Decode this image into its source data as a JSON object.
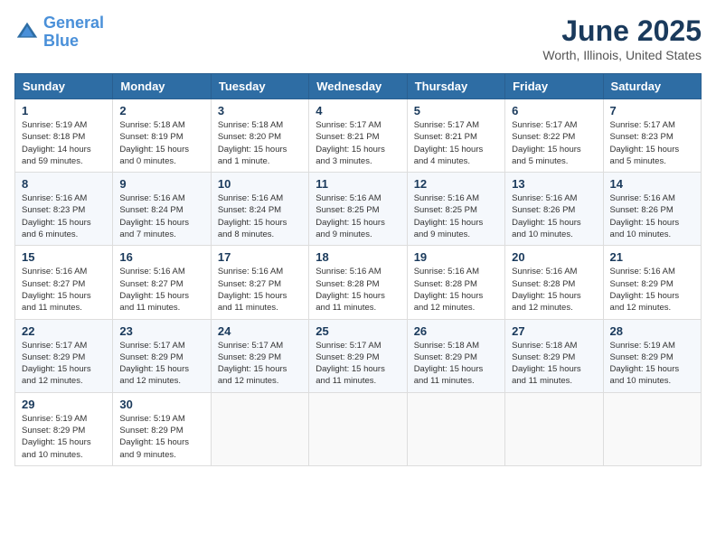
{
  "logo": {
    "line1": "General",
    "line2": "Blue"
  },
  "title": "June 2025",
  "subtitle": "Worth, Illinois, United States",
  "weekdays": [
    "Sunday",
    "Monday",
    "Tuesday",
    "Wednesday",
    "Thursday",
    "Friday",
    "Saturday"
  ],
  "weeks": [
    [
      {
        "day": "1",
        "sunrise": "5:19 AM",
        "sunset": "8:18 PM",
        "daylight": "14 hours and 59 minutes."
      },
      {
        "day": "2",
        "sunrise": "5:18 AM",
        "sunset": "8:19 PM",
        "daylight": "15 hours and 0 minutes."
      },
      {
        "day": "3",
        "sunrise": "5:18 AM",
        "sunset": "8:20 PM",
        "daylight": "15 hours and 1 minute."
      },
      {
        "day": "4",
        "sunrise": "5:17 AM",
        "sunset": "8:21 PM",
        "daylight": "15 hours and 3 minutes."
      },
      {
        "day": "5",
        "sunrise": "5:17 AM",
        "sunset": "8:21 PM",
        "daylight": "15 hours and 4 minutes."
      },
      {
        "day": "6",
        "sunrise": "5:17 AM",
        "sunset": "8:22 PM",
        "daylight": "15 hours and 5 minutes."
      },
      {
        "day": "7",
        "sunrise": "5:17 AM",
        "sunset": "8:23 PM",
        "daylight": "15 hours and 5 minutes."
      }
    ],
    [
      {
        "day": "8",
        "sunrise": "5:16 AM",
        "sunset": "8:23 PM",
        "daylight": "15 hours and 6 minutes."
      },
      {
        "day": "9",
        "sunrise": "5:16 AM",
        "sunset": "8:24 PM",
        "daylight": "15 hours and 7 minutes."
      },
      {
        "day": "10",
        "sunrise": "5:16 AM",
        "sunset": "8:24 PM",
        "daylight": "15 hours and 8 minutes."
      },
      {
        "day": "11",
        "sunrise": "5:16 AM",
        "sunset": "8:25 PM",
        "daylight": "15 hours and 9 minutes."
      },
      {
        "day": "12",
        "sunrise": "5:16 AM",
        "sunset": "8:25 PM",
        "daylight": "15 hours and 9 minutes."
      },
      {
        "day": "13",
        "sunrise": "5:16 AM",
        "sunset": "8:26 PM",
        "daylight": "15 hours and 10 minutes."
      },
      {
        "day": "14",
        "sunrise": "5:16 AM",
        "sunset": "8:26 PM",
        "daylight": "15 hours and 10 minutes."
      }
    ],
    [
      {
        "day": "15",
        "sunrise": "5:16 AM",
        "sunset": "8:27 PM",
        "daylight": "15 hours and 11 minutes."
      },
      {
        "day": "16",
        "sunrise": "5:16 AM",
        "sunset": "8:27 PM",
        "daylight": "15 hours and 11 minutes."
      },
      {
        "day": "17",
        "sunrise": "5:16 AM",
        "sunset": "8:27 PM",
        "daylight": "15 hours and 11 minutes."
      },
      {
        "day": "18",
        "sunrise": "5:16 AM",
        "sunset": "8:28 PM",
        "daylight": "15 hours and 11 minutes."
      },
      {
        "day": "19",
        "sunrise": "5:16 AM",
        "sunset": "8:28 PM",
        "daylight": "15 hours and 12 minutes."
      },
      {
        "day": "20",
        "sunrise": "5:16 AM",
        "sunset": "8:28 PM",
        "daylight": "15 hours and 12 minutes."
      },
      {
        "day": "21",
        "sunrise": "5:16 AM",
        "sunset": "8:29 PM",
        "daylight": "15 hours and 12 minutes."
      }
    ],
    [
      {
        "day": "22",
        "sunrise": "5:17 AM",
        "sunset": "8:29 PM",
        "daylight": "15 hours and 12 minutes."
      },
      {
        "day": "23",
        "sunrise": "5:17 AM",
        "sunset": "8:29 PM",
        "daylight": "15 hours and 12 minutes."
      },
      {
        "day": "24",
        "sunrise": "5:17 AM",
        "sunset": "8:29 PM",
        "daylight": "15 hours and 12 minutes."
      },
      {
        "day": "25",
        "sunrise": "5:17 AM",
        "sunset": "8:29 PM",
        "daylight": "15 hours and 11 minutes."
      },
      {
        "day": "26",
        "sunrise": "5:18 AM",
        "sunset": "8:29 PM",
        "daylight": "15 hours and 11 minutes."
      },
      {
        "day": "27",
        "sunrise": "5:18 AM",
        "sunset": "8:29 PM",
        "daylight": "15 hours and 11 minutes."
      },
      {
        "day": "28",
        "sunrise": "5:19 AM",
        "sunset": "8:29 PM",
        "daylight": "15 hours and 10 minutes."
      }
    ],
    [
      {
        "day": "29",
        "sunrise": "5:19 AM",
        "sunset": "8:29 PM",
        "daylight": "15 hours and 10 minutes."
      },
      {
        "day": "30",
        "sunrise": "5:19 AM",
        "sunset": "8:29 PM",
        "daylight": "15 hours and 9 minutes."
      },
      null,
      null,
      null,
      null,
      null
    ]
  ],
  "labels": {
    "sunrise": "Sunrise: ",
    "sunset": "Sunset: ",
    "daylight": "Daylight: "
  }
}
